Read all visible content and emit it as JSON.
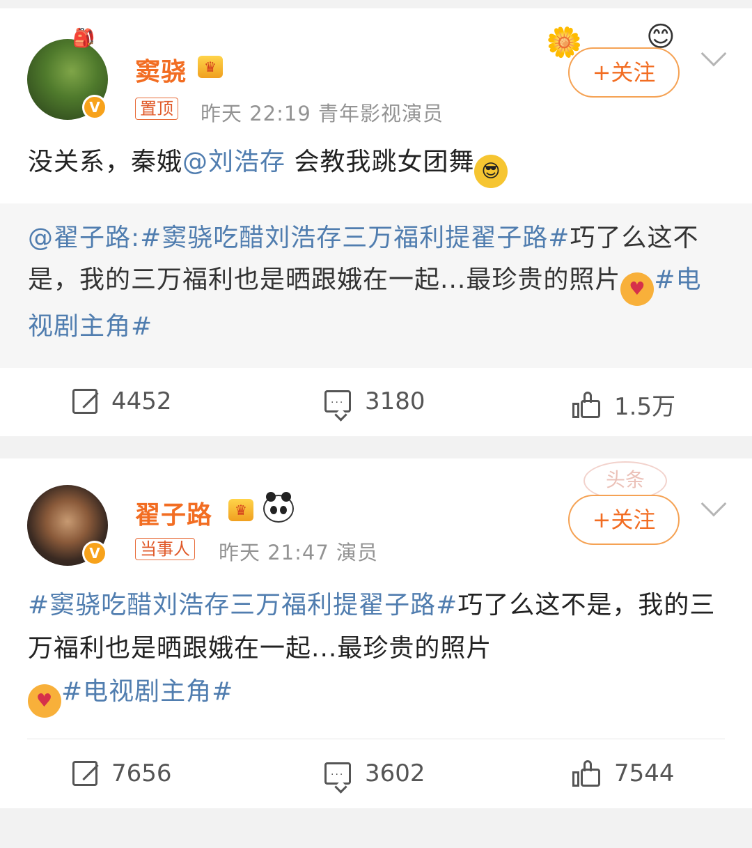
{
  "posts": [
    {
      "username": "窦骁",
      "tag": "置顶",
      "meta": "昨天 22:19  青年影视演员",
      "follow_label": "+关注",
      "text_prefix": "没关系，秦娥",
      "mention": "@刘浩存",
      "text_suffix": " 会教我跳女团舞",
      "repost": {
        "author": "@翟子路:",
        "hashtag1": "#窦骁吃醋刘浩存三万福利提翟子路#",
        "body": "巧了么这不是，我的三万福利也是晒跟娥在一起...最珍贵的照片",
        "hashtag2": "#电视剧主角#"
      },
      "actions": {
        "share": "4452",
        "comment": "3180",
        "like": "1.5万"
      }
    },
    {
      "username": "翟子路",
      "tag": "当事人",
      "meta": "昨天 21:47  演员",
      "follow_label": "+关注",
      "hashtag1": "#窦骁吃醋刘浩存三万福利提翟子路#",
      "body": "巧了么这不是，我的三万福利也是晒跟娥在一起...最珍贵的照片",
      "hashtag2": "#电视剧主角#",
      "stamp": "头条",
      "actions": {
        "share": "7656",
        "comment": "3602",
        "like": "7544"
      }
    }
  ],
  "icons": {
    "share": "share-icon",
    "comment": "comment-icon",
    "like": "like-icon",
    "verified": "verified-badge-icon",
    "crown": "crown-icon",
    "panda": "panda-icon"
  },
  "colors": {
    "username": "#f26d22",
    "link": "#507daf",
    "follow_border": "#f5a254",
    "verified": "#f7a21b"
  }
}
